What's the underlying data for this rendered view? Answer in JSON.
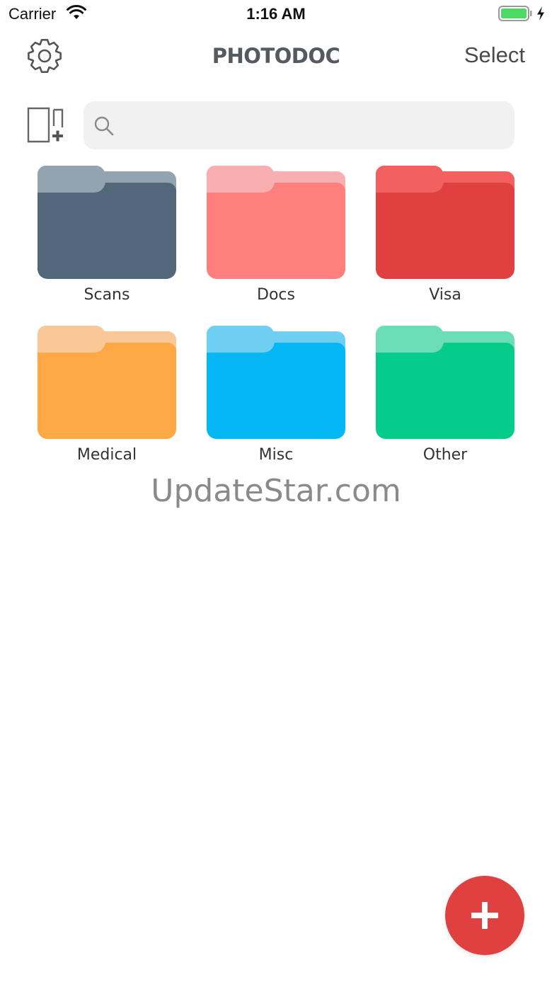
{
  "status_bar": {
    "carrier": "Carrier",
    "time": "1:16 AM",
    "battery_color": "#4cd964"
  },
  "nav": {
    "title": "PHOTODOC",
    "select_label": "Select",
    "settings_icon": "gear-icon"
  },
  "search": {
    "placeholder": "",
    "value": "",
    "icon": "search-icon"
  },
  "new_folder_icon": "new-folder-icon",
  "folders": [
    {
      "label": "Scans",
      "color": "#52687a",
      "tab_color": "#94a3b0"
    },
    {
      "label": "Docs",
      "color": "#ff7f7f",
      "tab_color": "#f9aeb0"
    },
    {
      "label": "Visa",
      "color": "#e04040",
      "tab_color": "#f26060"
    },
    {
      "label": "Medical",
      "color": "#ffa845",
      "tab_color": "#f9c896"
    },
    {
      "label": "Misc",
      "color": "#05b7f5",
      "tab_color": "#6fcff3"
    },
    {
      "label": "Other",
      "color": "#05cb8b",
      "tab_color": "#6bddb7"
    }
  ],
  "watermark": "UpdateStar.com",
  "fab": {
    "icon": "plus-icon",
    "color": "#e04040"
  }
}
